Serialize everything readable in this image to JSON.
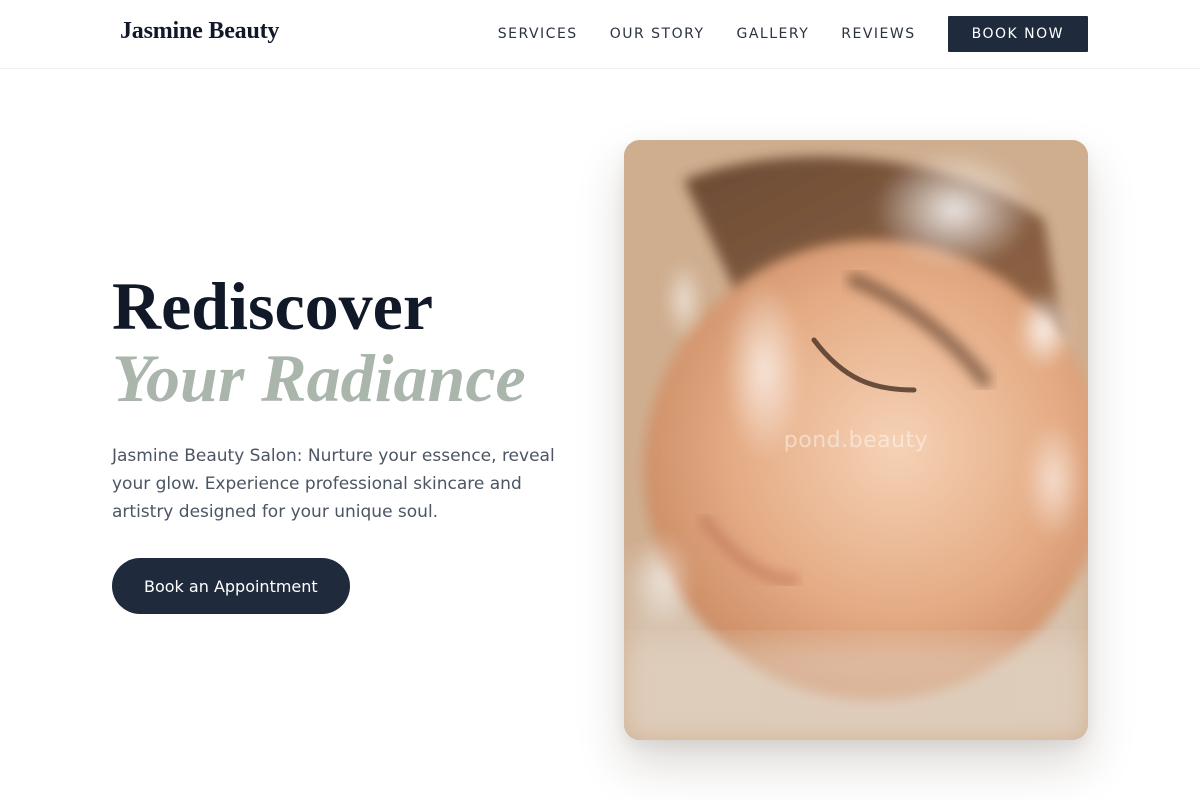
{
  "brand": {
    "name": "Jasmine Beauty"
  },
  "nav": {
    "links": [
      {
        "label": "SERVICES"
      },
      {
        "label": "OUR STORY"
      },
      {
        "label": "GALLERY"
      },
      {
        "label": "REVIEWS"
      }
    ],
    "cta_label": "BOOK NOW"
  },
  "hero": {
    "title_line1": "Rediscover",
    "title_line2": "Your Radiance",
    "description": "Jasmine Beauty Salon: Nurture your essence, reveal your glow. Experience professional skincare and artistry designed for your unique soul.",
    "cta_label": "Book an Appointment",
    "image": {
      "watermark": "pond.beauty"
    }
  },
  "colors": {
    "primary_dark": "#1f2a3c",
    "accent_sage": "#aab5ab",
    "heading": "#111827",
    "body_text": "#4b5563"
  }
}
